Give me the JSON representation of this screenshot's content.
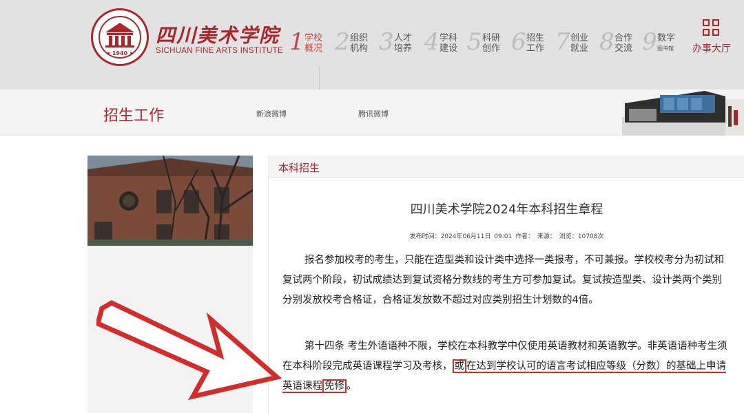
{
  "header": {
    "logo_cn": "四川美术学院",
    "logo_en": "SICHUAN FINE ARTS INSTITUTE",
    "logo_year": "• 1940 •",
    "office_label": "办事大厅",
    "nav": [
      {
        "num": "1",
        "label": "学校概况",
        "active": true
      },
      {
        "num": "2",
        "label": "组织机构"
      },
      {
        "num": "3",
        "label": "人才培养"
      },
      {
        "num": "4",
        "label": "学科建设"
      },
      {
        "num": "5",
        "label": "科研创作"
      },
      {
        "num": "6",
        "label": "招生工作"
      },
      {
        "num": "7",
        "label": "创业就业"
      },
      {
        "num": "8",
        "label": "合作交流"
      },
      {
        "num": "9",
        "label": "数字图书馆"
      }
    ]
  },
  "subhead": {
    "title": "招生工作",
    "links": [
      "新浪微博",
      "腾讯微博"
    ]
  },
  "article": {
    "category": "本科招生",
    "title": "四川美术学院2024年本科招生章程",
    "meta": "发布时间：2024年06月11日 09:01   作者：   来源：   浏览：10708次",
    "para1": "报名参加校考的考生，只能在造型类和设计类中选择一类报考，不可兼报。学校校考分为初试和复试两个阶段，初试成绩达到复试资格分数线的考生方可参加复试。复试按造型类、设计类两个类别分别发放校考合格证，合格证发放数不超过对应类别招生计划数的4倍。",
    "para2_a": "第十四条 考生外语语种不限，学校在本科教学中仅使用英语教材和英语教学。非英语语种考生须在本科阶段完成英语课程学习及考核，",
    "para2_or": "或",
    "para2_b": "在达到学校认可的语言考试相应等级（分数）的基础上申请英语课程",
    "para2_exempt": "免修",
    "para2_end": "。"
  },
  "colors": {
    "brand": "#a8262c",
    "annotation": "#d42b2b"
  }
}
